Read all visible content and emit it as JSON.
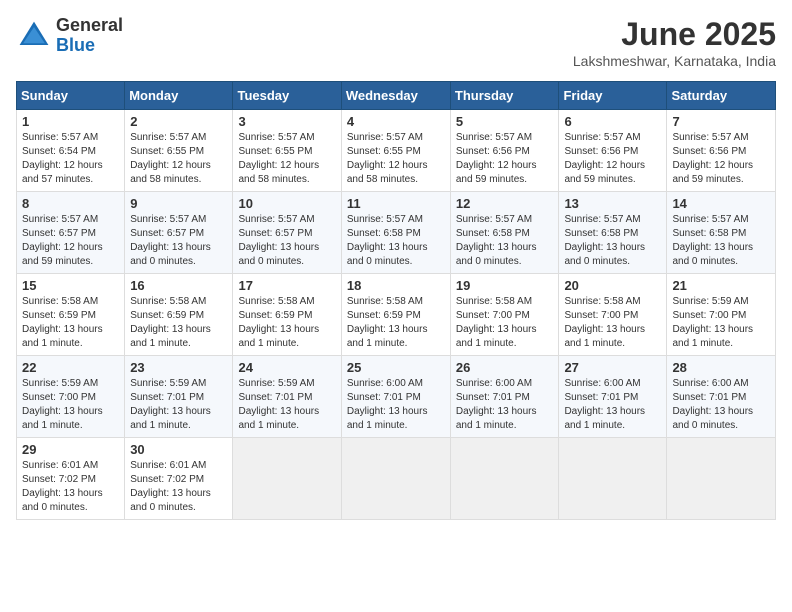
{
  "logo": {
    "general": "General",
    "blue": "Blue"
  },
  "title": "June 2025",
  "location": "Lakshmeshwar, Karnataka, India",
  "days_of_week": [
    "Sunday",
    "Monday",
    "Tuesday",
    "Wednesday",
    "Thursday",
    "Friday",
    "Saturday"
  ],
  "weeks": [
    [
      {
        "day": "1",
        "info": "Sunrise: 5:57 AM\nSunset: 6:54 PM\nDaylight: 12 hours\nand 57 minutes."
      },
      {
        "day": "2",
        "info": "Sunrise: 5:57 AM\nSunset: 6:55 PM\nDaylight: 12 hours\nand 58 minutes."
      },
      {
        "day": "3",
        "info": "Sunrise: 5:57 AM\nSunset: 6:55 PM\nDaylight: 12 hours\nand 58 minutes."
      },
      {
        "day": "4",
        "info": "Sunrise: 5:57 AM\nSunset: 6:55 PM\nDaylight: 12 hours\nand 58 minutes."
      },
      {
        "day": "5",
        "info": "Sunrise: 5:57 AM\nSunset: 6:56 PM\nDaylight: 12 hours\nand 59 minutes."
      },
      {
        "day": "6",
        "info": "Sunrise: 5:57 AM\nSunset: 6:56 PM\nDaylight: 12 hours\nand 59 minutes."
      },
      {
        "day": "7",
        "info": "Sunrise: 5:57 AM\nSunset: 6:56 PM\nDaylight: 12 hours\nand 59 minutes."
      }
    ],
    [
      {
        "day": "8",
        "info": "Sunrise: 5:57 AM\nSunset: 6:57 PM\nDaylight: 12 hours\nand 59 minutes."
      },
      {
        "day": "9",
        "info": "Sunrise: 5:57 AM\nSunset: 6:57 PM\nDaylight: 13 hours\nand 0 minutes."
      },
      {
        "day": "10",
        "info": "Sunrise: 5:57 AM\nSunset: 6:57 PM\nDaylight: 13 hours\nand 0 minutes."
      },
      {
        "day": "11",
        "info": "Sunrise: 5:57 AM\nSunset: 6:58 PM\nDaylight: 13 hours\nand 0 minutes."
      },
      {
        "day": "12",
        "info": "Sunrise: 5:57 AM\nSunset: 6:58 PM\nDaylight: 13 hours\nand 0 minutes."
      },
      {
        "day": "13",
        "info": "Sunrise: 5:57 AM\nSunset: 6:58 PM\nDaylight: 13 hours\nand 0 minutes."
      },
      {
        "day": "14",
        "info": "Sunrise: 5:57 AM\nSunset: 6:58 PM\nDaylight: 13 hours\nand 0 minutes."
      }
    ],
    [
      {
        "day": "15",
        "info": "Sunrise: 5:58 AM\nSunset: 6:59 PM\nDaylight: 13 hours\nand 1 minute."
      },
      {
        "day": "16",
        "info": "Sunrise: 5:58 AM\nSunset: 6:59 PM\nDaylight: 13 hours\nand 1 minute."
      },
      {
        "day": "17",
        "info": "Sunrise: 5:58 AM\nSunset: 6:59 PM\nDaylight: 13 hours\nand 1 minute."
      },
      {
        "day": "18",
        "info": "Sunrise: 5:58 AM\nSunset: 6:59 PM\nDaylight: 13 hours\nand 1 minute."
      },
      {
        "day": "19",
        "info": "Sunrise: 5:58 AM\nSunset: 7:00 PM\nDaylight: 13 hours\nand 1 minute."
      },
      {
        "day": "20",
        "info": "Sunrise: 5:58 AM\nSunset: 7:00 PM\nDaylight: 13 hours\nand 1 minute."
      },
      {
        "day": "21",
        "info": "Sunrise: 5:59 AM\nSunset: 7:00 PM\nDaylight: 13 hours\nand 1 minute."
      }
    ],
    [
      {
        "day": "22",
        "info": "Sunrise: 5:59 AM\nSunset: 7:00 PM\nDaylight: 13 hours\nand 1 minute."
      },
      {
        "day": "23",
        "info": "Sunrise: 5:59 AM\nSunset: 7:01 PM\nDaylight: 13 hours\nand 1 minute."
      },
      {
        "day": "24",
        "info": "Sunrise: 5:59 AM\nSunset: 7:01 PM\nDaylight: 13 hours\nand 1 minute."
      },
      {
        "day": "25",
        "info": "Sunrise: 6:00 AM\nSunset: 7:01 PM\nDaylight: 13 hours\nand 1 minute."
      },
      {
        "day": "26",
        "info": "Sunrise: 6:00 AM\nSunset: 7:01 PM\nDaylight: 13 hours\nand 1 minute."
      },
      {
        "day": "27",
        "info": "Sunrise: 6:00 AM\nSunset: 7:01 PM\nDaylight: 13 hours\nand 1 minute."
      },
      {
        "day": "28",
        "info": "Sunrise: 6:00 AM\nSunset: 7:01 PM\nDaylight: 13 hours\nand 0 minutes."
      }
    ],
    [
      {
        "day": "29",
        "info": "Sunrise: 6:01 AM\nSunset: 7:02 PM\nDaylight: 13 hours\nand 0 minutes."
      },
      {
        "day": "30",
        "info": "Sunrise: 6:01 AM\nSunset: 7:02 PM\nDaylight: 13 hours\nand 0 minutes."
      },
      {
        "day": "",
        "info": ""
      },
      {
        "day": "",
        "info": ""
      },
      {
        "day": "",
        "info": ""
      },
      {
        "day": "",
        "info": ""
      },
      {
        "day": "",
        "info": ""
      }
    ]
  ]
}
